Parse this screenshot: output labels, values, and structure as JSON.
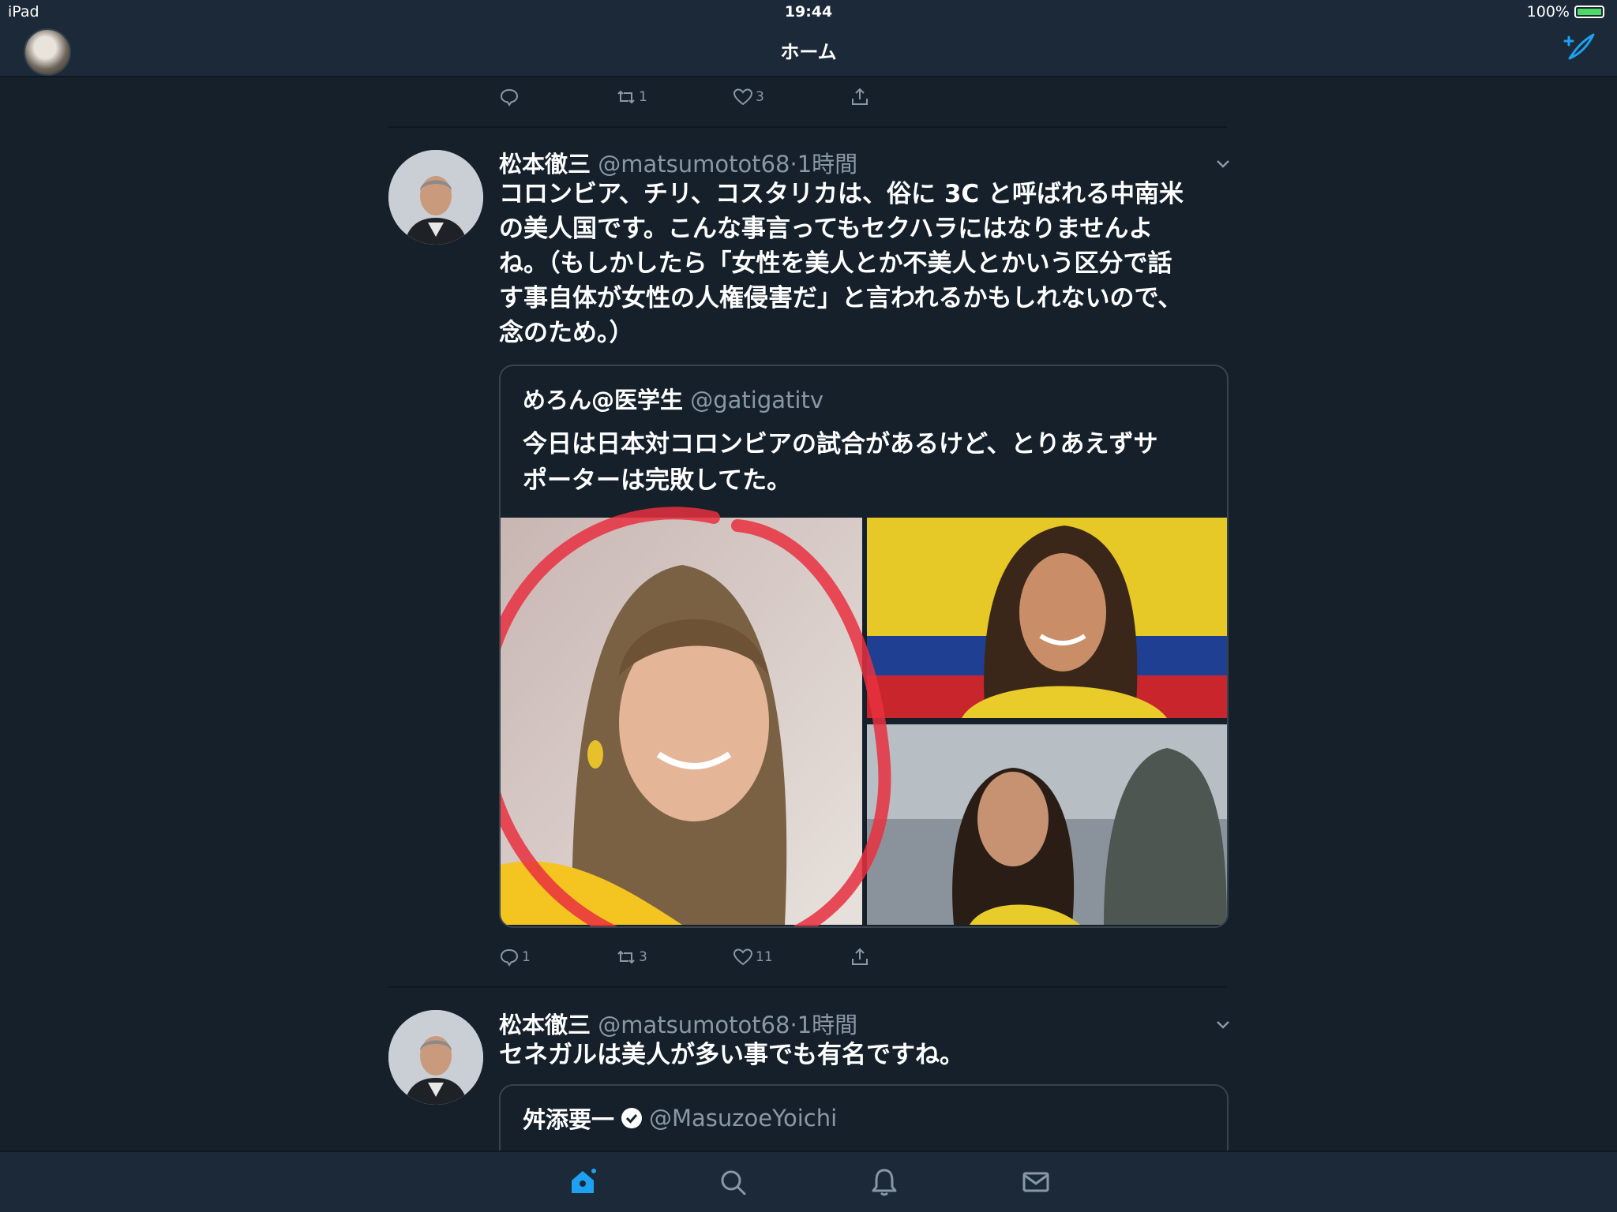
{
  "status_bar": {
    "device": "iPad",
    "time": "19:44",
    "battery": "100%"
  },
  "nav": {
    "title": "ホーム"
  },
  "top_actions": {
    "reply_count": "",
    "retweet_count": "1",
    "like_count": "3"
  },
  "tweets": [
    {
      "name": "松本徹三",
      "handle": "@matsumotot68",
      "time": "·1時間",
      "text_lines": [
        "コロンビア、チリ、コスタリカは、俗に 3C と呼ばれる中南米",
        "の美人国です。こんな事言ってもセクハラにはなりませんよ",
        "ね。（もしかしたら「女性を美人とか不美人とかいう区分で話",
        "す事自体が女性の人権侵害だ」と言われるかもしれないので、",
        "念のため。）"
      ],
      "quote": {
        "name": "めろん@医学生",
        "handle": "@gatigatitv",
        "text_lines": [
          "今日は日本対コロンビアの試合があるけど、とりあえずサ",
          "ポーターは完敗してた。"
        ]
      },
      "reply_count": "1",
      "retweet_count": "3",
      "like_count": "11"
    },
    {
      "name": "松本徹三",
      "handle": "@matsumotot68",
      "time": "·1時間",
      "text": "セネガルは美人が多い事でも有名ですね。",
      "quote": {
        "name": "舛添要一",
        "handle": "@MasuzoeYoichi"
      }
    }
  ],
  "colors": {
    "background": "#15202b",
    "bar": "#1c2938",
    "accent": "#1da1f2",
    "muted": "#8899a6",
    "annotation": "#e8303f"
  },
  "icons": {
    "tabs": [
      "home-icon",
      "search-icon",
      "bell-icon",
      "mail-icon"
    ],
    "compose": "compose-tweet-icon"
  }
}
